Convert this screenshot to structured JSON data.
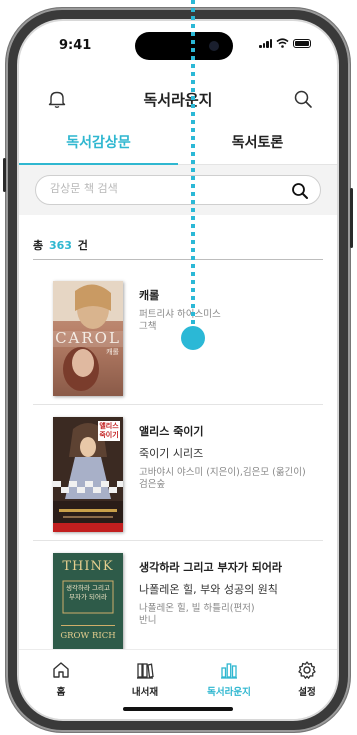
{
  "status_bar": {
    "time": "9:41"
  },
  "header": {
    "title": "독서라운지"
  },
  "tabs": [
    {
      "label": "독서감상문",
      "active": true
    },
    {
      "label": "독서토론",
      "active": false
    }
  ],
  "search": {
    "placeholder": "감상문 책 검색",
    "value": ""
  },
  "summary": {
    "prefix": "총",
    "count": "363",
    "suffix": "건"
  },
  "books": [
    {
      "title": "캐롤",
      "subtitle": "",
      "author": "퍼트리샤 하이스미스",
      "publisher": "그책",
      "cover_text": "CAROL",
      "cover_subtext": "캐롤"
    },
    {
      "title": "앨리스 죽이기",
      "subtitle": "죽이기 시리즈",
      "author": "고바야시 야스미 (지은이),김은모 (옮긴이)",
      "publisher": "검은숲",
      "cover_text": "앨리스 죽이기"
    },
    {
      "title": "생각하라 그리고 부자가 되어라",
      "subtitle": "나폴레온 힐, 부와 성공의 원칙",
      "author": "나폴레온 힐, 빌 하틀리(편저)",
      "publisher": "반니",
      "cover_text": "THINK",
      "cover_subtext": "생각하라 그리고 부자가 되어라",
      "cover_text2": "GROW RICH"
    }
  ],
  "tabbar": [
    {
      "label": "홈",
      "icon": "home-icon",
      "active": false
    },
    {
      "label": "내서재",
      "icon": "bookshelf-icon",
      "active": false
    },
    {
      "label": "독서라운지",
      "icon": "lounge-icon",
      "active": true
    },
    {
      "label": "설정",
      "icon": "gear-icon",
      "active": false
    }
  ],
  "colors": {
    "accent": "#2fb7d0",
    "text": "#222222",
    "muted": "#888888"
  }
}
